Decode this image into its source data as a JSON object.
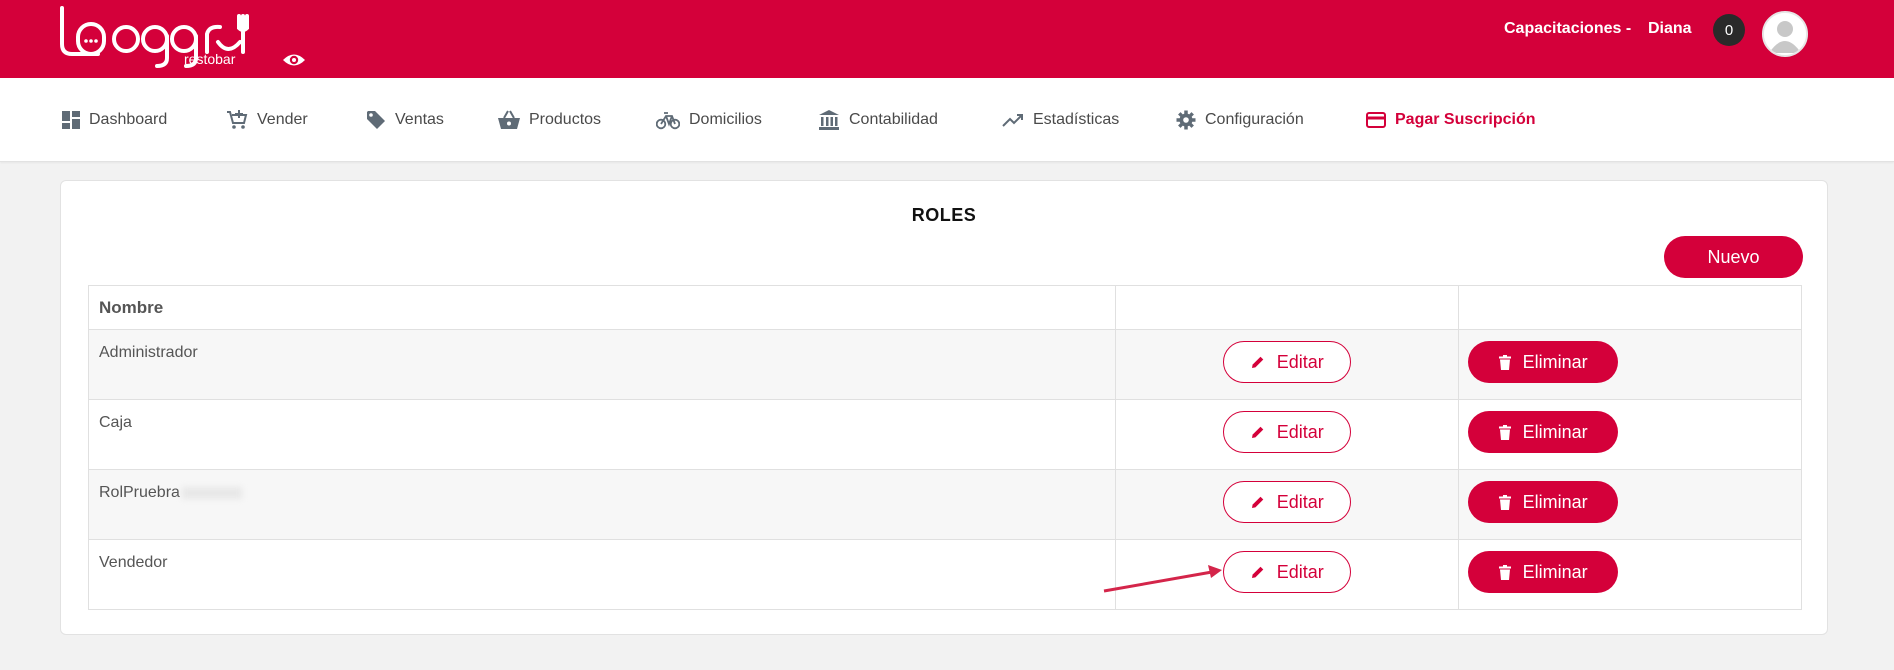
{
  "header": {
    "logo_text": "loggro",
    "logo_subtext": "restobar",
    "training_label": "Capacitaciones -",
    "user_name": "Diana",
    "notification_count": "0",
    "brand_color": "#d4003a"
  },
  "nav": {
    "items": [
      {
        "label": "Dashboard",
        "icon": "dashboard-icon"
      },
      {
        "label": "Vender",
        "icon": "cart-icon"
      },
      {
        "label": "Ventas",
        "icon": "tag-icon"
      },
      {
        "label": "Productos",
        "icon": "basket-icon"
      },
      {
        "label": "Domicilios",
        "icon": "bicycle-icon"
      },
      {
        "label": "Contabilidad",
        "icon": "bank-icon"
      },
      {
        "label": "Estadísticas",
        "icon": "trending-up-icon"
      },
      {
        "label": "Configuración",
        "icon": "gear-icon"
      },
      {
        "label": "Pagar Suscripción",
        "icon": "credit-card-icon"
      }
    ]
  },
  "roles": {
    "title": "ROLES",
    "new_button": "Nuevo",
    "table": {
      "header_name": "Nombre",
      "rows": [
        {
          "name": "Administrador"
        },
        {
          "name": "Caja"
        },
        {
          "name": "RolPruebra"
        },
        {
          "name": "Vendedor"
        }
      ],
      "edit_label": "Editar",
      "delete_label": "Eliminar"
    }
  }
}
